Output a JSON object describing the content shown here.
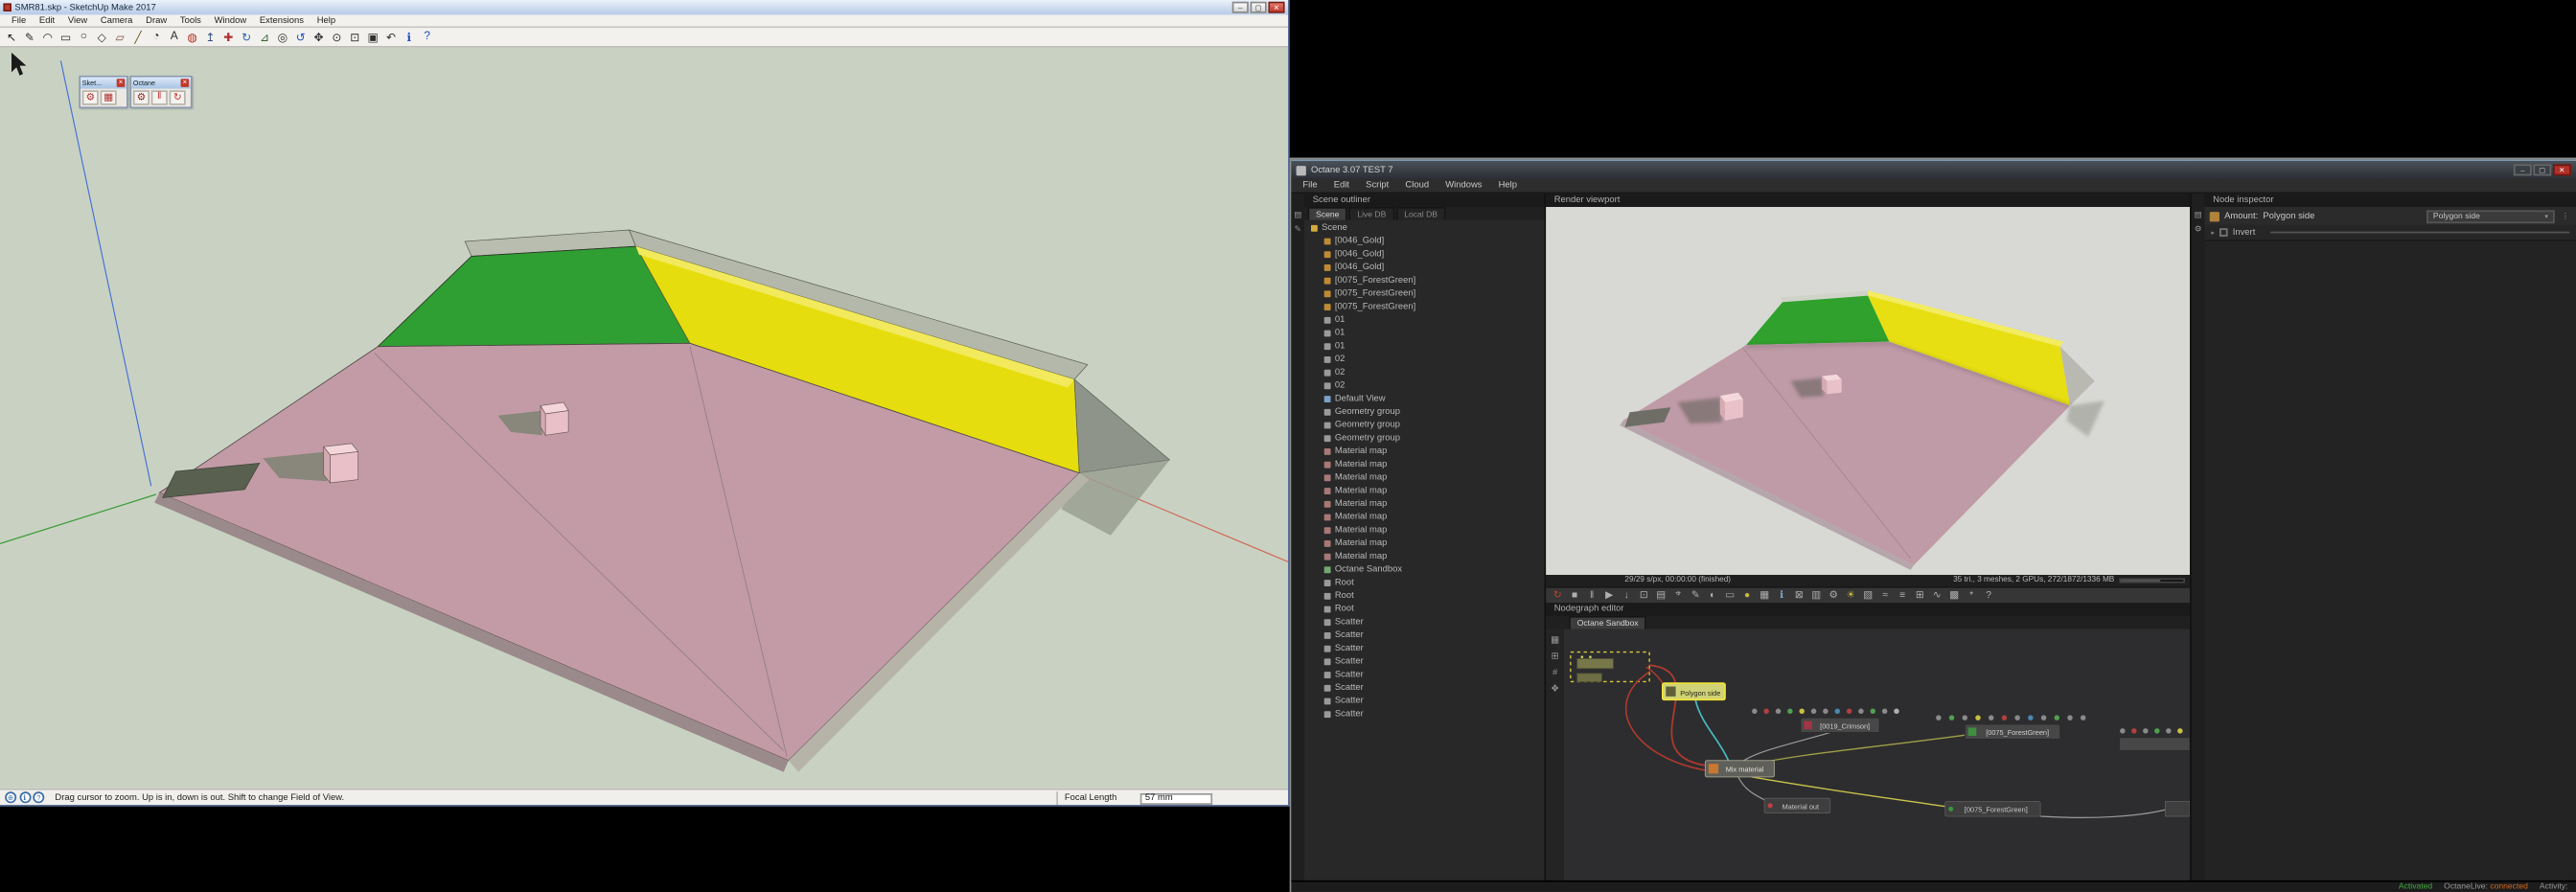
{
  "chrome": {
    "minimize": "–",
    "maximize": "▢",
    "close": "✕"
  },
  "sketchup": {
    "title": "SMR81.skp - SketchUp Make 2017",
    "menus": [
      "File",
      "Edit",
      "View",
      "Camera",
      "Draw",
      "Tools",
      "Window",
      "Extensions",
      "Help"
    ],
    "toolbar": [
      {
        "name": "select",
        "glyph": "↖",
        "color": "#1a1a1a"
      },
      {
        "name": "line",
        "glyph": "✎",
        "color": "#303030"
      },
      {
        "name": "arc",
        "glyph": "◠",
        "color": "#303030"
      },
      {
        "name": "rectangle",
        "glyph": "▭",
        "color": "#303030"
      },
      {
        "name": "circle",
        "glyph": "○",
        "color": "#303030"
      },
      {
        "name": "polygon",
        "glyph": "◇",
        "color": "#303030"
      },
      {
        "name": "eraser",
        "glyph": "▱",
        "color": "#8a4a3a"
      },
      {
        "name": "tape-measure",
        "glyph": "╱",
        "color": "#6a5a20"
      },
      {
        "name": "protractor",
        "glyph": "◔",
        "color": "#303030"
      },
      {
        "name": "text",
        "glyph": "A",
        "color": "#303030"
      },
      {
        "name": "paint-bucket",
        "glyph": "◍",
        "color": "#b03020"
      },
      {
        "name": "push-pull",
        "glyph": "↥",
        "color": "#305080"
      },
      {
        "name": "move",
        "glyph": "✚",
        "color": "#b03030"
      },
      {
        "name": "rotate",
        "glyph": "↻",
        "color": "#3060b0"
      },
      {
        "name": "scale",
        "glyph": "⊿",
        "color": "#306030"
      },
      {
        "name": "offset",
        "glyph": "◎",
        "color": "#303030"
      },
      {
        "name": "orbit",
        "glyph": "↺",
        "color": "#2050c0"
      },
      {
        "name": "pan",
        "glyph": "✥",
        "color": "#303030"
      },
      {
        "name": "zoom",
        "glyph": "⊙",
        "color": "#303030"
      },
      {
        "name": "zoom-window",
        "glyph": "⊡",
        "color": "#303030"
      },
      {
        "name": "zoom-extents",
        "glyph": "▣",
        "color": "#303030"
      },
      {
        "name": "previous",
        "glyph": "↶",
        "color": "#303030"
      },
      {
        "name": "model-info",
        "glyph": "ℹ",
        "color": "#2050c0"
      },
      {
        "name": "instructor",
        "glyph": "?",
        "color": "#2050c0"
      }
    ],
    "palettes": [
      {
        "title": "Sket...",
        "buttons": [
          {
            "name": "sketchucation-tools",
            "glyph": "⚙",
            "color": "#b03030"
          },
          {
            "name": "sketchucation-grid",
            "glyph": "▦",
            "color": "#b03030"
          }
        ]
      },
      {
        "title": "Octane",
        "buttons": [
          {
            "name": "octane-render-settings",
            "glyph": "⚙",
            "color": "#8a2020"
          },
          {
            "name": "octane-pause",
            "glyph": "‖",
            "color": "#c03030"
          },
          {
            "name": "octane-refresh",
            "glyph": "↻",
            "color": "#c03030"
          }
        ]
      }
    ],
    "status_icons": [
      {
        "name": "geolocation",
        "glyph": "⊕",
        "color": "#3a6ea8"
      },
      {
        "name": "info",
        "glyph": "ℹ",
        "color": "#3a6ea8"
      },
      {
        "name": "help",
        "glyph": "?",
        "color": "#3a6ea8"
      }
    ],
    "statusbar": {
      "hint": "Drag cursor to zoom. Up is in, down is out. Shift to change Field of View.",
      "focal_label": "Focal Length",
      "focal_value": "57 mm"
    }
  },
  "octane": {
    "title": "Octane 3.07 TEST 7",
    "menus": [
      "File",
      "Edit",
      "Script",
      "Cloud",
      "Windows",
      "Help"
    ],
    "outliner": {
      "header": "Scene outliner",
      "tabs": [
        "Scene",
        "Live DB",
        "Local DB"
      ],
      "strip": [
        {
          "name": "outliner-panel",
          "glyph": "▤"
        },
        {
          "name": "outliner-edit",
          "glyph": "✎"
        }
      ],
      "items": [
        {
          "label": "Scene",
          "type": "folder"
        },
        {
          "label": "[0046_Gold]",
          "type": "material"
        },
        {
          "label": "[0046_Gold]",
          "type": "material"
        },
        {
          "label": "[0046_Gold]",
          "type": "material"
        },
        {
          "label": "[0075_ForestGreen]",
          "type": "material"
        },
        {
          "label": "[0075_ForestGreen]",
          "type": "material"
        },
        {
          "label": "[0075_ForestGreen]",
          "type": "material"
        },
        {
          "label": "01",
          "type": "object"
        },
        {
          "label": "01",
          "type": "object"
        },
        {
          "label": "01",
          "type": "object"
        },
        {
          "label": "02",
          "type": "object"
        },
        {
          "label": "02",
          "type": "object"
        },
        {
          "label": "02",
          "type": "object"
        },
        {
          "label": "Default View",
          "type": "view"
        },
        {
          "label": "Geometry group",
          "type": "group"
        },
        {
          "label": "Geometry group",
          "type": "group"
        },
        {
          "label": "Geometry group",
          "type": "group"
        },
        {
          "label": "Material map",
          "type": "map"
        },
        {
          "label": "Material map",
          "type": "map"
        },
        {
          "label": "Material map",
          "type": "map"
        },
        {
          "label": "Material map",
          "type": "map"
        },
        {
          "label": "Material map",
          "type": "map"
        },
        {
          "label": "Material map",
          "type": "map"
        },
        {
          "label": "Material map",
          "type": "map"
        },
        {
          "label": "Material map",
          "type": "map"
        },
        {
          "label": "Material map",
          "type": "map"
        },
        {
          "label": "Octane Sandbox",
          "type": "sandbox"
        },
        {
          "label": "Root",
          "type": "root"
        },
        {
          "label": "Root",
          "type": "root"
        },
        {
          "label": "Root",
          "type": "root"
        },
        {
          "label": "Scatter",
          "type": "scatter"
        },
        {
          "label": "Scatter",
          "type": "scatter"
        },
        {
          "label": "Scatter",
          "type": "scatter"
        },
        {
          "label": "Scatter",
          "type": "scatter"
        },
        {
          "label": "Scatter",
          "type": "scatter"
        },
        {
          "label": "Scatter",
          "type": "scatter"
        },
        {
          "label": "Scatter",
          "type": "scatter"
        },
        {
          "label": "Scatter",
          "type": "scatter"
        }
      ]
    },
    "viewport": {
      "header": "Render viewport",
      "status_left": "29/29 s/px, 00:00:00 (finished)",
      "status_right": "35 tri., 3 meshes, 2 GPUs, 272/1872/1336 MB",
      "toolbar": [
        {
          "name": "render-restart",
          "glyph": "↻",
          "color": "#c04030"
        },
        {
          "name": "render-stop",
          "glyph": "■",
          "color": "#b0b0b0"
        },
        {
          "name": "render-pause",
          "glyph": "‖",
          "color": "#b0b0b0"
        },
        {
          "name": "render-play",
          "glyph": "▶",
          "color": "#b0b0b0"
        },
        {
          "name": "save-render",
          "glyph": "↓",
          "color": "#b0b0b0"
        },
        {
          "name": "copy-render",
          "glyph": "⊡",
          "color": "#b0b0b0"
        },
        {
          "name": "clipboard",
          "glyph": "▤",
          "color": "#b0b0b0"
        },
        {
          "name": "camera-focus",
          "glyph": "⌖",
          "color": "#b0b0b0"
        },
        {
          "name": "material-picker",
          "glyph": "✎",
          "color": "#b0b0b0"
        },
        {
          "name": "white-balance-picker",
          "glyph": "◐",
          "color": "#b0b0b0"
        },
        {
          "name": "region-render",
          "glyph": "▭",
          "color": "#b0b0b0"
        },
        {
          "name": "clay-mode",
          "glyph": "●",
          "color": "#c8b840"
        },
        {
          "name": "subsampling",
          "glyph": "▦",
          "color": "#b0b0b0"
        },
        {
          "name": "info-channel",
          "glyph": "ℹ",
          "color": "#80a8d0"
        },
        {
          "name": "lock-resolution",
          "glyph": "⊠",
          "color": "#b0b0b0"
        },
        {
          "name": "film-settings",
          "glyph": "▥",
          "color": "#b0b0b0"
        },
        {
          "name": "camera-settings",
          "glyph": "⚙",
          "color": "#b0b0b0"
        },
        {
          "name": "environment",
          "glyph": "☀",
          "color": "#c8b840"
        },
        {
          "name": "imager",
          "glyph": "▧",
          "color": "#b0b0b0"
        },
        {
          "name": "postprocess",
          "glyph": "≈",
          "color": "#b0b0b0"
        },
        {
          "name": "render-layers",
          "glyph": "≡",
          "color": "#b0b0b0"
        },
        {
          "name": "render-passes",
          "glyph": "⊞",
          "color": "#b0b0b0"
        },
        {
          "name": "network-render",
          "glyph": "∿",
          "color": "#b0b0b0"
        },
        {
          "name": "gpu-settings",
          "glyph": "▩",
          "color": "#b0b0b0"
        },
        {
          "name": "preferences",
          "glyph": "*",
          "color": "#b0b0b0"
        },
        {
          "name": "help",
          "glyph": "?",
          "color": "#b0b0b0"
        }
      ]
    },
    "nodegraph": {
      "header": "Nodegraph editor",
      "tab": "Octane Sandbox",
      "strip": [
        {
          "name": "nodes-palette",
          "glyph": "▦"
        },
        {
          "name": "zoom-fit",
          "glyph": "⊞"
        },
        {
          "name": "snap-grid",
          "glyph": "#"
        },
        {
          "name": "pan-tool",
          "glyph": "✥"
        }
      ],
      "nodes": {
        "selected": "Polygon side",
        "crimson": "[0019_Crimson]",
        "forestgreen_top": "[0075_ForestGreen]",
        "mix": "Mix material",
        "material_out": "Material out",
        "forestgreen_bottom": "[0075_ForestGreen]"
      },
      "dot_rows": {
        "crimson": [
          "#8a8a8a",
          "#b04040",
          "#8a8a8a",
          "#50a050",
          "#c8c040",
          "#8a8a8a",
          "#8a8a8a",
          "#4888b0",
          "#b04040",
          "#8a8a8a",
          "#50a050",
          "#8a8a8a",
          "#b0b0b0"
        ],
        "forestgreen": [
          "#8a8a8a",
          "#50a050",
          "#8a8a8a",
          "#c8c040",
          "#8a8a8a",
          "#b04040",
          "#8a8a8a",
          "#4888b0",
          "#8a8a8a",
          "#50a050",
          "#8a8a8a",
          "#8a8a8a"
        ],
        "right": [
          "#8a8a8a",
          "#b04040",
          "#8a8a8a",
          "#50a050",
          "#8a8a8a",
          "#c8c040"
        ]
      }
    },
    "inspector": {
      "header": "Node inspector",
      "strip": [
        {
          "name": "inspector-panel",
          "glyph": "▤"
        },
        {
          "name": "inspector-settings",
          "glyph": "⚙"
        }
      ],
      "amount_label": "Amount:",
      "amount_value": "Polygon side",
      "dropdown_value": "Polygon side",
      "extra_button": "⋮",
      "invert_label": "Invert"
    },
    "statusbar": {
      "activated": "Activated",
      "live_label": "OctaneLive:",
      "live_value": "connected",
      "activity_label": "Activity:"
    }
  }
}
